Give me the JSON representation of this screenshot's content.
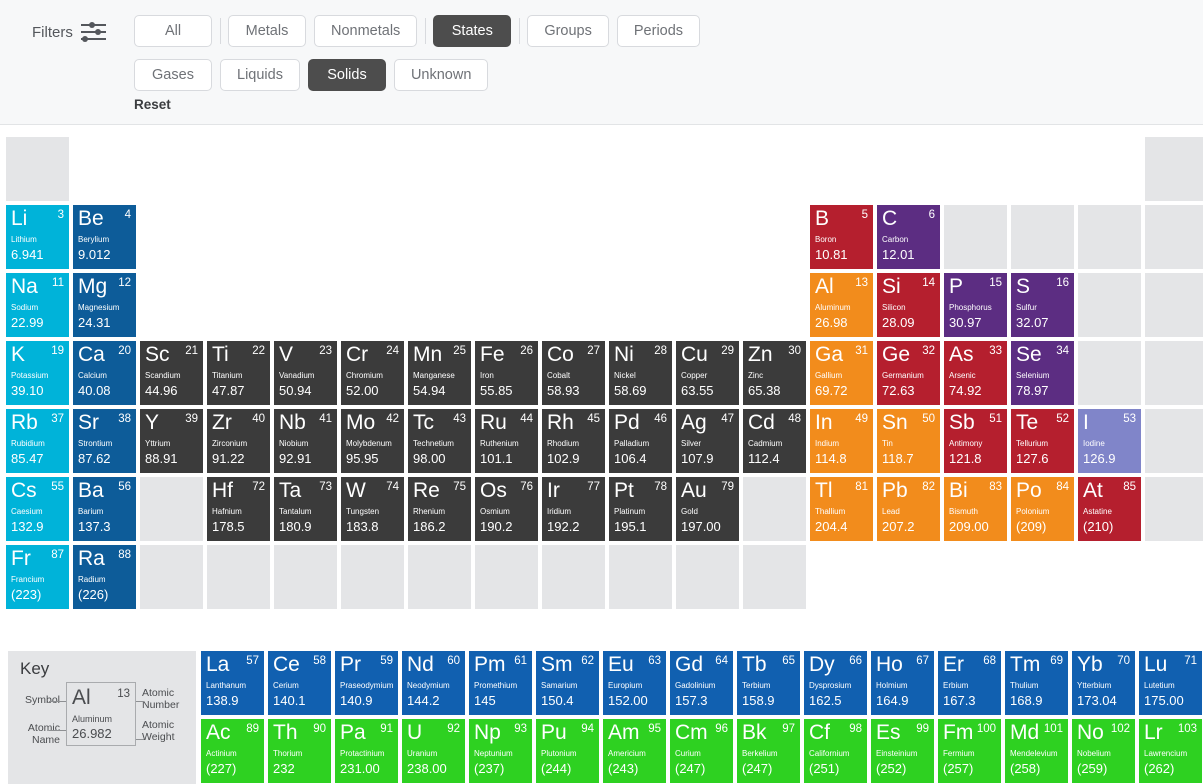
{
  "filter_bar": {
    "label": "Filters",
    "icon": "filter-sliders-icon",
    "reset_label": "Reset",
    "row1": [
      {
        "label": "All",
        "active": false
      },
      {
        "sep": true
      },
      {
        "label": "Metals",
        "active": false
      },
      {
        "label": "Nonmetals",
        "active": false
      },
      {
        "sep": true
      },
      {
        "label": "States",
        "active": true
      },
      {
        "sep": true
      },
      {
        "label": "Groups",
        "active": false
      },
      {
        "label": "Periods",
        "active": false
      }
    ],
    "row2": [
      {
        "label": "Gases",
        "active": false
      },
      {
        "label": "Liquids",
        "active": false
      },
      {
        "label": "Solids",
        "active": true
      },
      {
        "label": "Unknown",
        "active": false
      }
    ]
  },
  "key": {
    "title": "Key",
    "symbol_label": "Symbol",
    "atomic_name_label": "Atomic\nName",
    "atomic_number_label": "Atomic\nNumber",
    "atomic_weight_label": "Atomic\nWeight",
    "example": {
      "symbol": "Al",
      "number": "13",
      "name": "Aluminum",
      "weight": "26.982"
    }
  },
  "colors": {
    "alkali_metal": "#00b3d9",
    "alkaline_earth": "#0d5c99",
    "transition_metal": "#3b3b3b",
    "post_transition": "#f28c1c",
    "metalloid": "#b51f2e",
    "nonmetal": "#5c2d82",
    "halogen_solid": "#8085c9",
    "lanthanide": "#1160b0",
    "actinide": "#2ed121",
    "placeholder": "#e4e5e7"
  },
  "main_grid": {
    "rows": 7,
    "cols": 18,
    "cells": [
      {
        "r": 1,
        "c": 1,
        "state": "placeholder"
      },
      {
        "r": 1,
        "c": 18,
        "state": "placeholder"
      },
      {
        "r": 2,
        "c": 1,
        "sym": "Li",
        "num": "3",
        "name": "Lithium",
        "wt": "6.941",
        "cat": "alkali_metal"
      },
      {
        "r": 2,
        "c": 2,
        "sym": "Be",
        "num": "4",
        "name": "Berylium",
        "wt": "9.012",
        "cat": "alkaline_earth"
      },
      {
        "r": 2,
        "c": 13,
        "sym": "B",
        "num": "5",
        "name": "Boron",
        "wt": "10.81",
        "cat": "metalloid"
      },
      {
        "r": 2,
        "c": 14,
        "sym": "C",
        "num": "6",
        "name": "Carbon",
        "wt": "12.01",
        "cat": "nonmetal"
      },
      {
        "r": 2,
        "c": 15,
        "state": "placeholder"
      },
      {
        "r": 2,
        "c": 16,
        "state": "placeholder"
      },
      {
        "r": 2,
        "c": 17,
        "state": "placeholder"
      },
      {
        "r": 2,
        "c": 18,
        "state": "placeholder"
      },
      {
        "r": 3,
        "c": 1,
        "sym": "Na",
        "num": "11",
        "name": "Sodium",
        "wt": "22.99",
        "cat": "alkali_metal"
      },
      {
        "r": 3,
        "c": 2,
        "sym": "Mg",
        "num": "12",
        "name": "Magnesium",
        "wt": "24.31",
        "cat": "alkaline_earth"
      },
      {
        "r": 3,
        "c": 13,
        "sym": "Al",
        "num": "13",
        "name": "Aluminum",
        "wt": "26.98",
        "cat": "post_transition"
      },
      {
        "r": 3,
        "c": 14,
        "sym": "Si",
        "num": "14",
        "name": "Silicon",
        "wt": "28.09",
        "cat": "metalloid"
      },
      {
        "r": 3,
        "c": 15,
        "sym": "P",
        "num": "15",
        "name": "Phosphorus",
        "wt": "30.97",
        "cat": "nonmetal"
      },
      {
        "r": 3,
        "c": 16,
        "sym": "S",
        "num": "16",
        "name": "Sulfur",
        "wt": "32.07",
        "cat": "nonmetal"
      },
      {
        "r": 3,
        "c": 17,
        "state": "placeholder"
      },
      {
        "r": 3,
        "c": 18,
        "state": "placeholder"
      },
      {
        "r": 4,
        "c": 1,
        "sym": "K",
        "num": "19",
        "name": "Potassium",
        "wt": "39.10",
        "cat": "alkali_metal"
      },
      {
        "r": 4,
        "c": 2,
        "sym": "Ca",
        "num": "20",
        "name": "Calcium",
        "wt": "40.08",
        "cat": "alkaline_earth"
      },
      {
        "r": 4,
        "c": 3,
        "sym": "Sc",
        "num": "21",
        "name": "Scandium",
        "wt": "44.96",
        "cat": "transition_metal"
      },
      {
        "r": 4,
        "c": 4,
        "sym": "Ti",
        "num": "22",
        "name": "Titanium",
        "wt": "47.87",
        "cat": "transition_metal"
      },
      {
        "r": 4,
        "c": 5,
        "sym": "V",
        "num": "23",
        "name": "Vanadium",
        "wt": "50.94",
        "cat": "transition_metal"
      },
      {
        "r": 4,
        "c": 6,
        "sym": "Cr",
        "num": "24",
        "name": "Chromium",
        "wt": "52.00",
        "cat": "transition_metal"
      },
      {
        "r": 4,
        "c": 7,
        "sym": "Mn",
        "num": "25",
        "name": "Manganese",
        "wt": "54.94",
        "cat": "transition_metal"
      },
      {
        "r": 4,
        "c": 8,
        "sym": "Fe",
        "num": "26",
        "name": "Iron",
        "wt": "55.85",
        "cat": "transition_metal"
      },
      {
        "r": 4,
        "c": 9,
        "sym": "Co",
        "num": "27",
        "name": "Cobalt",
        "wt": "58.93",
        "cat": "transition_metal"
      },
      {
        "r": 4,
        "c": 10,
        "sym": "Ni",
        "num": "28",
        "name": "Nickel",
        "wt": "58.69",
        "cat": "transition_metal"
      },
      {
        "r": 4,
        "c": 11,
        "sym": "Cu",
        "num": "29",
        "name": "Copper",
        "wt": "63.55",
        "cat": "transition_metal"
      },
      {
        "r": 4,
        "c": 12,
        "sym": "Zn",
        "num": "30",
        "name": "Zinc",
        "wt": "65.38",
        "cat": "transition_metal"
      },
      {
        "r": 4,
        "c": 13,
        "sym": "Ga",
        "num": "31",
        "name": "Gallium",
        "wt": "69.72",
        "cat": "post_transition"
      },
      {
        "r": 4,
        "c": 14,
        "sym": "Ge",
        "num": "32",
        "name": "Germanium",
        "wt": "72.63",
        "cat": "metalloid"
      },
      {
        "r": 4,
        "c": 15,
        "sym": "As",
        "num": "33",
        "name": "Arsenic",
        "wt": "74.92",
        "cat": "metalloid"
      },
      {
        "r": 4,
        "c": 16,
        "sym": "Se",
        "num": "34",
        "name": "Selenium",
        "wt": "78.97",
        "cat": "nonmetal"
      },
      {
        "r": 4,
        "c": 17,
        "state": "placeholder"
      },
      {
        "r": 4,
        "c": 18,
        "state": "placeholder"
      },
      {
        "r": 5,
        "c": 1,
        "sym": "Rb",
        "num": "37",
        "name": "Rubidium",
        "wt": "85.47",
        "cat": "alkali_metal"
      },
      {
        "r": 5,
        "c": 2,
        "sym": "Sr",
        "num": "38",
        "name": "Strontium",
        "wt": "87.62",
        "cat": "alkaline_earth"
      },
      {
        "r": 5,
        "c": 3,
        "sym": "Y",
        "num": "39",
        "name": "Yttrium",
        "wt": "88.91",
        "cat": "transition_metal"
      },
      {
        "r": 5,
        "c": 4,
        "sym": "Zr",
        "num": "40",
        "name": "Zirconium",
        "wt": "91.22",
        "cat": "transition_metal"
      },
      {
        "r": 5,
        "c": 5,
        "sym": "Nb",
        "num": "41",
        "name": "Niobium",
        "wt": "92.91",
        "cat": "transition_metal"
      },
      {
        "r": 5,
        "c": 6,
        "sym": "Mo",
        "num": "42",
        "name": "Molybdenum",
        "wt": "95.95",
        "cat": "transition_metal"
      },
      {
        "r": 5,
        "c": 7,
        "sym": "Tc",
        "num": "43",
        "name": "Technetium",
        "wt": "98.00",
        "cat": "transition_metal"
      },
      {
        "r": 5,
        "c": 8,
        "sym": "Ru",
        "num": "44",
        "name": "Ruthenium",
        "wt": "101.1",
        "cat": "transition_metal"
      },
      {
        "r": 5,
        "c": 9,
        "sym": "Rh",
        "num": "45",
        "name": "Rhodium",
        "wt": "102.9",
        "cat": "transition_metal"
      },
      {
        "r": 5,
        "c": 10,
        "sym": "Pd",
        "num": "46",
        "name": "Palladium",
        "wt": "106.4",
        "cat": "transition_metal"
      },
      {
        "r": 5,
        "c": 11,
        "sym": "Ag",
        "num": "47",
        "name": "Silver",
        "wt": "107.9",
        "cat": "transition_metal"
      },
      {
        "r": 5,
        "c": 12,
        "sym": "Cd",
        "num": "48",
        "name": "Cadmium",
        "wt": "112.4",
        "cat": "transition_metal"
      },
      {
        "r": 5,
        "c": 13,
        "sym": "In",
        "num": "49",
        "name": "Indium",
        "wt": "114.8",
        "cat": "post_transition"
      },
      {
        "r": 5,
        "c": 14,
        "sym": "Sn",
        "num": "50",
        "name": "Tin",
        "wt": "118.7",
        "cat": "post_transition"
      },
      {
        "r": 5,
        "c": 15,
        "sym": "Sb",
        "num": "51",
        "name": "Antimony",
        "wt": "121.8",
        "cat": "metalloid"
      },
      {
        "r": 5,
        "c": 16,
        "sym": "Te",
        "num": "52",
        "name": "Tellurium",
        "wt": "127.6",
        "cat": "metalloid"
      },
      {
        "r": 5,
        "c": 17,
        "sym": "I",
        "num": "53",
        "name": "Iodine",
        "wt": "126.9",
        "cat": "halogen_solid"
      },
      {
        "r": 5,
        "c": 18,
        "state": "placeholder"
      },
      {
        "r": 6,
        "c": 1,
        "sym": "Cs",
        "num": "55",
        "name": "Caesium",
        "wt": "132.9",
        "cat": "alkali_metal"
      },
      {
        "r": 6,
        "c": 2,
        "sym": "Ba",
        "num": "56",
        "name": "Barium",
        "wt": "137.3",
        "cat": "alkaline_earth"
      },
      {
        "r": 6,
        "c": 3,
        "state": "placeholder"
      },
      {
        "r": 6,
        "c": 4,
        "sym": "Hf",
        "num": "72",
        "name": "Hafnium",
        "wt": "178.5",
        "cat": "transition_metal"
      },
      {
        "r": 6,
        "c": 5,
        "sym": "Ta",
        "num": "73",
        "name": "Tantalum",
        "wt": "180.9",
        "cat": "transition_metal"
      },
      {
        "r": 6,
        "c": 6,
        "sym": "W",
        "num": "74",
        "name": "Tungsten",
        "wt": "183.8",
        "cat": "transition_metal"
      },
      {
        "r": 6,
        "c": 7,
        "sym": "Re",
        "num": "75",
        "name": "Rhenium",
        "wt": "186.2",
        "cat": "transition_metal"
      },
      {
        "r": 6,
        "c": 8,
        "sym": "Os",
        "num": "76",
        "name": "Osmium",
        "wt": "190.2",
        "cat": "transition_metal"
      },
      {
        "r": 6,
        "c": 9,
        "sym": "Ir",
        "num": "77",
        "name": "Iridium",
        "wt": "192.2",
        "cat": "transition_metal"
      },
      {
        "r": 6,
        "c": 10,
        "sym": "Pt",
        "num": "78",
        "name": "Platinum",
        "wt": "195.1",
        "cat": "transition_metal"
      },
      {
        "r": 6,
        "c": 11,
        "sym": "Au",
        "num": "79",
        "name": "Gold",
        "wt": "197.00",
        "cat": "transition_metal"
      },
      {
        "r": 6,
        "c": 12,
        "state": "placeholder"
      },
      {
        "r": 6,
        "c": 13,
        "sym": "Tl",
        "num": "81",
        "name": "Thallium",
        "wt": "204.4",
        "cat": "post_transition"
      },
      {
        "r": 6,
        "c": 14,
        "sym": "Pb",
        "num": "82",
        "name": "Lead",
        "wt": "207.2",
        "cat": "post_transition"
      },
      {
        "r": 6,
        "c": 15,
        "sym": "Bi",
        "num": "83",
        "name": "Bismuth",
        "wt": "209.00",
        "cat": "post_transition"
      },
      {
        "r": 6,
        "c": 16,
        "sym": "Po",
        "num": "84",
        "name": "Polonium",
        "wt": "(209)",
        "cat": "post_transition"
      },
      {
        "r": 6,
        "c": 17,
        "sym": "At",
        "num": "85",
        "name": "Astatine",
        "wt": "(210)",
        "cat": "metalloid"
      },
      {
        "r": 6,
        "c": 18,
        "state": "placeholder"
      },
      {
        "r": 7,
        "c": 1,
        "sym": "Fr",
        "num": "87",
        "name": "Francium",
        "wt": "(223)",
        "cat": "alkali_metal"
      },
      {
        "r": 7,
        "c": 2,
        "sym": "Ra",
        "num": "88",
        "name": "Radium",
        "wt": "(226)",
        "cat": "alkaline_earth"
      },
      {
        "r": 7,
        "c": 3,
        "state": "placeholder"
      },
      {
        "r": 7,
        "c": 4,
        "state": "placeholder"
      },
      {
        "r": 7,
        "c": 5,
        "state": "placeholder"
      },
      {
        "r": 7,
        "c": 6,
        "state": "placeholder"
      },
      {
        "r": 7,
        "c": 7,
        "state": "placeholder"
      },
      {
        "r": 7,
        "c": 8,
        "state": "placeholder"
      },
      {
        "r": 7,
        "c": 9,
        "state": "placeholder"
      },
      {
        "r": 7,
        "c": 10,
        "state": "placeholder"
      },
      {
        "r": 7,
        "c": 11,
        "state": "placeholder"
      },
      {
        "r": 7,
        "c": 12,
        "state": "placeholder"
      }
    ]
  },
  "fblock_grid": {
    "rows": 2,
    "cols": 15,
    "cells": [
      {
        "r": 1,
        "c": 1,
        "sym": "La",
        "num": "57",
        "name": "Lanthanum",
        "wt": "138.9",
        "cat": "lanthanide"
      },
      {
        "r": 1,
        "c": 2,
        "sym": "Ce",
        "num": "58",
        "name": "Cerium",
        "wt": "140.1",
        "cat": "lanthanide"
      },
      {
        "r": 1,
        "c": 3,
        "sym": "Pr",
        "num": "59",
        "name": "Praseodymium",
        "wt": "140.9",
        "cat": "lanthanide"
      },
      {
        "r": 1,
        "c": 4,
        "sym": "Nd",
        "num": "60",
        "name": "Neodymium",
        "wt": "144.2",
        "cat": "lanthanide"
      },
      {
        "r": 1,
        "c": 5,
        "sym": "Pm",
        "num": "61",
        "name": "Promethium",
        "wt": "145",
        "cat": "lanthanide"
      },
      {
        "r": 1,
        "c": 6,
        "sym": "Sm",
        "num": "62",
        "name": "Samarium",
        "wt": "150.4",
        "cat": "lanthanide"
      },
      {
        "r": 1,
        "c": 7,
        "sym": "Eu",
        "num": "63",
        "name": "Europium",
        "wt": "152.00",
        "cat": "lanthanide"
      },
      {
        "r": 1,
        "c": 8,
        "sym": "Gd",
        "num": "64",
        "name": "Gadolinium",
        "wt": "157.3",
        "cat": "lanthanide"
      },
      {
        "r": 1,
        "c": 9,
        "sym": "Tb",
        "num": "65",
        "name": "Terbium",
        "wt": "158.9",
        "cat": "lanthanide"
      },
      {
        "r": 1,
        "c": 10,
        "sym": "Dy",
        "num": "66",
        "name": "Dysprosium",
        "wt": "162.5",
        "cat": "lanthanide"
      },
      {
        "r": 1,
        "c": 11,
        "sym": "Ho",
        "num": "67",
        "name": "Holmium",
        "wt": "164.9",
        "cat": "lanthanide"
      },
      {
        "r": 1,
        "c": 12,
        "sym": "Er",
        "num": "68",
        "name": "Erbium",
        "wt": "167.3",
        "cat": "lanthanide"
      },
      {
        "r": 1,
        "c": 13,
        "sym": "Tm",
        "num": "69",
        "name": "Thulium",
        "wt": "168.9",
        "cat": "lanthanide"
      },
      {
        "r": 1,
        "c": 14,
        "sym": "Yb",
        "num": "70",
        "name": "Ytterbium",
        "wt": "173.04",
        "cat": "lanthanide"
      },
      {
        "r": 1,
        "c": 15,
        "sym": "Lu",
        "num": "71",
        "name": "Lutetium",
        "wt": "175.00",
        "cat": "lanthanide"
      },
      {
        "r": 2,
        "c": 1,
        "sym": "Ac",
        "num": "89",
        "name": "Actinium",
        "wt": "(227)",
        "cat": "actinide"
      },
      {
        "r": 2,
        "c": 2,
        "sym": "Th",
        "num": "90",
        "name": "Thorium",
        "wt": "232",
        "cat": "actinide"
      },
      {
        "r": 2,
        "c": 3,
        "sym": "Pa",
        "num": "91",
        "name": "Protactinium",
        "wt": "231.00",
        "cat": "actinide"
      },
      {
        "r": 2,
        "c": 4,
        "sym": "U",
        "num": "92",
        "name": "Uranium",
        "wt": "238.00",
        "cat": "actinide"
      },
      {
        "r": 2,
        "c": 5,
        "sym": "Np",
        "num": "93",
        "name": "Neptunium",
        "wt": "(237)",
        "cat": "actinide"
      },
      {
        "r": 2,
        "c": 6,
        "sym": "Pu",
        "num": "94",
        "name": "Plutonium",
        "wt": "(244)",
        "cat": "actinide"
      },
      {
        "r": 2,
        "c": 7,
        "sym": "Am",
        "num": "95",
        "name": "Americium",
        "wt": "(243)",
        "cat": "actinide"
      },
      {
        "r": 2,
        "c": 8,
        "sym": "Cm",
        "num": "96",
        "name": "Curium",
        "wt": "(247)",
        "cat": "actinide"
      },
      {
        "r": 2,
        "c": 9,
        "sym": "Bk",
        "num": "97",
        "name": "Berkelium",
        "wt": "(247)",
        "cat": "actinide"
      },
      {
        "r": 2,
        "c": 10,
        "sym": "Cf",
        "num": "98",
        "name": "Californium",
        "wt": "(251)",
        "cat": "actinide"
      },
      {
        "r": 2,
        "c": 11,
        "sym": "Es",
        "num": "99",
        "name": "Einsteinium",
        "wt": "(252)",
        "cat": "actinide"
      },
      {
        "r": 2,
        "c": 12,
        "sym": "Fm",
        "num": "100",
        "name": "Fermium",
        "wt": "(257)",
        "cat": "actinide"
      },
      {
        "r": 2,
        "c": 13,
        "sym": "Md",
        "num": "101",
        "name": "Mendelevium",
        "wt": "(258)",
        "cat": "actinide"
      },
      {
        "r": 2,
        "c": 14,
        "sym": "No",
        "num": "102",
        "name": "Nobelium",
        "wt": "(259)",
        "cat": "actinide"
      },
      {
        "r": 2,
        "c": 15,
        "sym": "Lr",
        "num": "103",
        "name": "Lawrencium",
        "wt": "(262)",
        "cat": "actinide"
      }
    ]
  }
}
